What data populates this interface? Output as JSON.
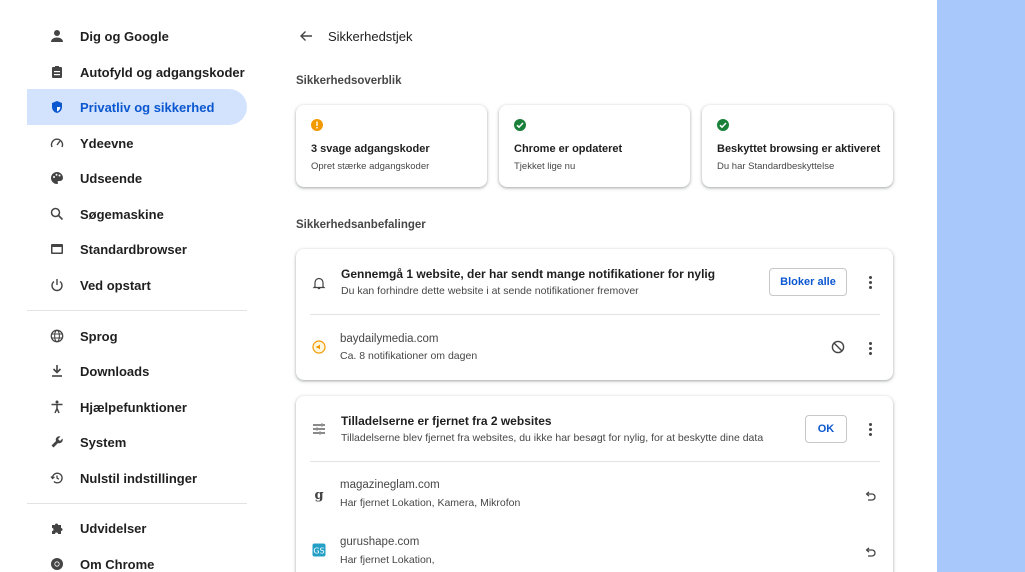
{
  "sidebar": {
    "items": [
      {
        "label": "Dig og Google",
        "icon": "person-icon"
      },
      {
        "label": "Autofyld og adgangskoder",
        "icon": "clipboard-icon"
      },
      {
        "label": "Privatliv og sikkerhed",
        "icon": "shield-icon",
        "active": true
      },
      {
        "label": "Ydeevne",
        "icon": "speedometer-icon"
      },
      {
        "label": "Udseende",
        "icon": "palette-icon"
      },
      {
        "label": "Søgemaskine",
        "icon": "search-icon"
      },
      {
        "label": "Standardbrowser",
        "icon": "browser-icon"
      },
      {
        "label": "Ved opstart",
        "icon": "power-icon"
      },
      {
        "label": "Sprog",
        "icon": "globe-icon"
      },
      {
        "label": "Downloads",
        "icon": "download-icon"
      },
      {
        "label": "Hjælpefunktioner",
        "icon": "accessibility-icon"
      },
      {
        "label": "System",
        "icon": "wrench-icon"
      },
      {
        "label": "Nulstil indstillinger",
        "icon": "history-icon"
      },
      {
        "label": "Udvidelser",
        "icon": "puzzle-icon"
      },
      {
        "label": "Om Chrome",
        "icon": "chrome-icon"
      }
    ]
  },
  "header": {
    "title": "Sikkerhedstjek"
  },
  "overview": {
    "section_title": "Sikkerhedsoverblik",
    "cards": [
      {
        "title": "3 svage adgangskoder",
        "subtitle": "Opret stærke adgangskoder",
        "status": "warning",
        "color": "#f29900"
      },
      {
        "title": "Chrome er opdateret",
        "subtitle": "Tjekket lige nu",
        "status": "ok",
        "color": "#188038"
      },
      {
        "title": "Beskyttet browsing er aktiveret",
        "subtitle": "Du har Standardbeskyttelse",
        "status": "ok",
        "color": "#188038"
      }
    ]
  },
  "recommendations": {
    "section_title": "Sikkerhedsanbefalinger",
    "notifications": {
      "title": "Gennemgå 1 website, der har sendt mange notifikationer for nylig",
      "subtitle": "Du kan forhindre dette website i at sende notifikationer fremover",
      "button": "Bloker alle",
      "sites": [
        {
          "name": "baydailymedia.com",
          "detail": "Ca. 8 notifikationer om dagen"
        }
      ]
    },
    "permissions": {
      "title": "Tilladelserne er fjernet fra 2 websites",
      "subtitle": "Tilladelserne blev fjernet fra websites, du ikke har besøgt for nylig, for at beskytte dine data",
      "button": "OK",
      "sites": [
        {
          "name": "magazineglam.com",
          "detail": "Har fjernet Lokation, Kamera, Mikrofon"
        },
        {
          "name": "gurushape.com",
          "detail": "Har fjernet Lokation,"
        }
      ]
    }
  },
  "colors": {
    "accent": "#0b57d0",
    "active_bg": "#d3e3fd",
    "right_strip": "#a8c7fa"
  }
}
